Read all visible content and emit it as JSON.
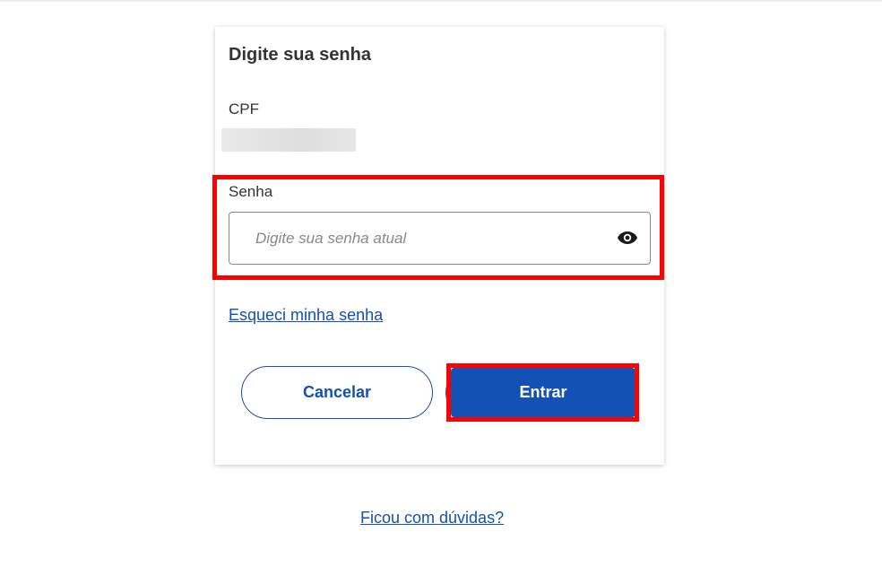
{
  "card": {
    "title": "Digite sua senha",
    "cpf_label": "CPF",
    "password_label": "Senha",
    "password_placeholder": "Digite sua senha atual",
    "password_value": "",
    "forgot_link": "Esqueci minha senha",
    "cancel_button": "Cancelar",
    "enter_button": "Entrar"
  },
  "footer": {
    "help_link": "Ficou com dúvidas?"
  },
  "icons": {
    "show_password": "eye-icon"
  },
  "colors": {
    "primary": "#1351b4",
    "highlight": "#ff0000",
    "text": "#333333"
  }
}
